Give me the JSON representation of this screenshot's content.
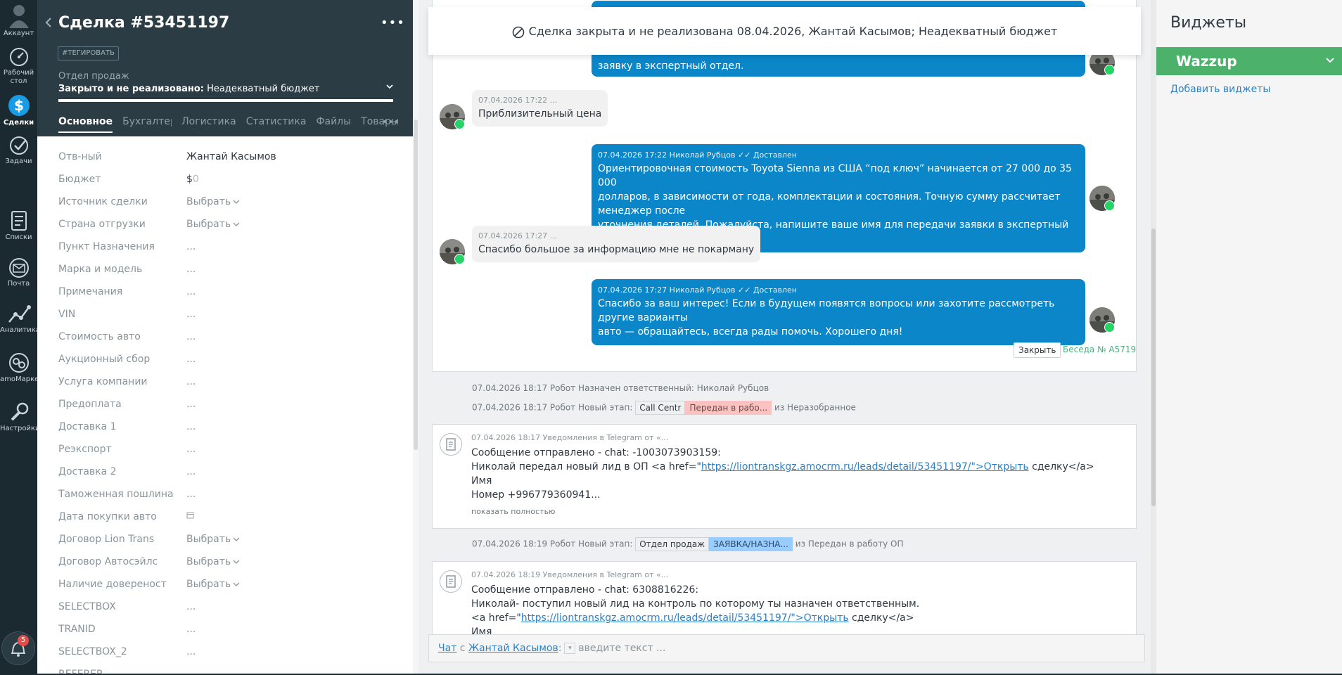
{
  "nav": {
    "account": "Аккаунт",
    "desktop": "Рабочий стол",
    "deals": "Сделки",
    "tasks": "Задачи",
    "lists": "Списки",
    "mail": "Почта",
    "analytics": "Аналитика",
    "market": "amoМаркет",
    "settings": "Настройки",
    "badge_count": "5"
  },
  "card": {
    "title": "Сделка #53451197",
    "more": "•••",
    "tag_button": "#ТЕГИРОВАТЬ",
    "pipeline": "Отдел продаж",
    "status_prefix": "Закрыто и не реализовано:",
    "status_reason": "Неадекватный бюджет",
    "tabs": [
      "Основное",
      "Бухгалтерия",
      "Логистика",
      "Статистика",
      "Файлы",
      "Товары"
    ],
    "tab_more": "•••",
    "fields": [
      {
        "label": "Отв-ный",
        "value": "Жантай Касымов"
      },
      {
        "label": "Бюджет",
        "value": "$",
        "suffix": "0"
      },
      {
        "label": "Источник сделки",
        "value": "Выбрать"
      },
      {
        "label": "Страна отгрузки",
        "value": "Выбрать"
      },
      {
        "label": "Пункт Назначения",
        "value": "..."
      },
      {
        "label": "Марка и модель",
        "value": "..."
      },
      {
        "label": "Примечания",
        "value": "..."
      },
      {
        "label": "VIN",
        "value": "..."
      },
      {
        "label": "Стоимость авто",
        "value": "..."
      },
      {
        "label": "Аукционный сбор",
        "value": "..."
      },
      {
        "label": "Услуга компании",
        "value": "..."
      },
      {
        "label": "Предоплата",
        "value": "..."
      },
      {
        "label": "Доставка 1",
        "value": "..."
      },
      {
        "label": "Реэкспорт",
        "value": "..."
      },
      {
        "label": "Доставка 2",
        "value": "..."
      },
      {
        "label": "Таможенная пошлина",
        "value": "..."
      },
      {
        "label": "Дата покупки авто",
        "value": ""
      },
      {
        "label": "Договор Lion Trans",
        "value": "Выбрать"
      },
      {
        "label": "Договор Автосэйлс",
        "value": "Выбрать"
      },
      {
        "label": "Наличие довереност",
        "value": "Выбрать"
      },
      {
        "label": "SELECTBOX",
        "value": "..."
      },
      {
        "label": "TRANID",
        "value": "..."
      },
      {
        "label": "SELECTBOX_2",
        "value": "..."
      },
      {
        "label": "REFERER",
        "value": ""
      }
    ]
  },
  "feed": {
    "banner": "Сделка закрыта и не реализована 08.04.2026, Жантай Касымов; Неадекватный бюджет",
    "top_partial_text": "заявку в экспертный отдел.",
    "messages": [
      {
        "meta": "07.04.2026 17:22 ...",
        "text": "Приблизительный цена"
      },
      {
        "meta": "07.04.2026 17:22 Николай Рубцов",
        "status": "Доставлен",
        "lines": [
          "Ориентировочная стоимость Toyota Sienna из США “под ключ” начинается от 27 000 до 35 000",
          "долларов, в зависимости от года, комплектации и состояния. Точную сумму рассчитает менеджер после",
          "уточнения деталей. Пожалуйста, напишите ваше имя для передачи заявки в экспертный отдел."
        ]
      },
      {
        "meta": "07.04.2026 17:27 ...",
        "text": "Спасибо большое за информацию мне не покарману"
      },
      {
        "meta": "07.04.2026 17:27 Николай Рубцов",
        "status": "Доставлен",
        "lines": [
          "Спасибо за ваш интерес! Если в будущем появятся вопросы или захотите рассмотреть другие варианты",
          "авто — обращайтесь, всегда рады помочь. Хорошего дня!"
        ]
      }
    ],
    "close_button": "Закрыть",
    "conversation": "Беседа № A5719",
    "robot1": "07.04.2026 18:17 Робот Назначен ответственный: Николай Рубцов",
    "robot2_prefix": "07.04.2026 18:17 Робот Новый этап:",
    "robot2_from": "Call Centr",
    "robot2_stage": "Передан в рабо...",
    "robot2_suffix": "из Неразобранное",
    "note1": {
      "meta": "07.04.2026 18:17 Уведомления в Telegram от «...",
      "line1": "Сообщение отправлено - chat: -1003073903159:",
      "line2_pre": "Николай передал новый лид в ОП <a href=\"",
      "line2_link": "https://liontranskgz.amocrm.ru/leads/detail/53451197/\">Открыть",
      "line2_post": " сделку</a>",
      "line3": "Имя",
      "line4": "Номер +996779360941...",
      "show_full": "показать полностью"
    },
    "robot3_prefix": "07.04.2026 18:19 Робот Новый этап:",
    "robot3_from": "Отдел продаж",
    "robot3_stage": "ЗАЯВКА/НАЗНА...",
    "robot3_suffix": "из Передан в работу ОП",
    "note2": {
      "meta": "07.04.2026 18:19 Уведомления в Telegram от «...",
      "line1": "Сообщение отправлено - chat: 6308816226:",
      "line2": "Николай- поступил новый лид на контроль по которому ты назначен ответственным.",
      "line3_pre": "<a href=\"",
      "line3_link": "https://liontranskgz.amocrm.ru/leads/detail/53451197/\">Открыть",
      "line3_post": " сделку</a>",
      "line4": "Имя"
    },
    "composer": {
      "chat": "Чат",
      "with": "с",
      "contact": "Жантай Касымов",
      "colon": ":",
      "placeholder": "введите текст ..."
    }
  },
  "widgets": {
    "title": "Виджеты",
    "wazzup": "Wazzup",
    "add": "Добавить виджеты"
  },
  "colors": {
    "accent_blue": "#0b86c9",
    "wazzup_green": "#4cb16a",
    "whatsapp": "#25d366"
  }
}
